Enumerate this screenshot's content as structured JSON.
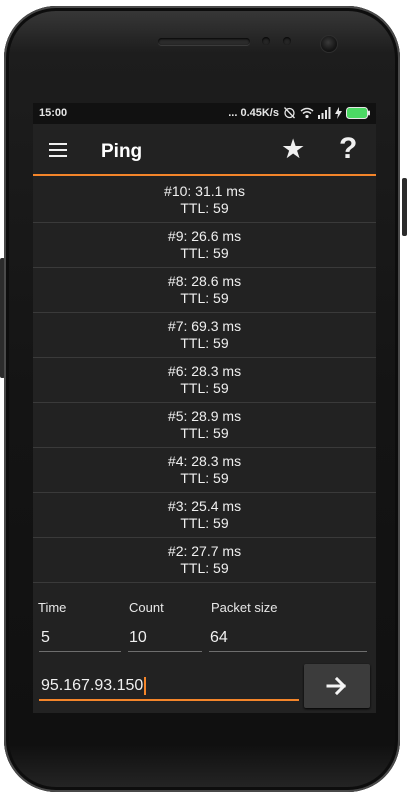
{
  "status_bar": {
    "time": "15:00",
    "speed": "... 0.45K/s"
  },
  "app_bar": {
    "title": "Ping",
    "icons": [
      "menu-icon",
      "star-icon",
      "help-icon"
    ],
    "star_glyph": "★",
    "help_glyph": "?"
  },
  "results": [
    {
      "line1": "#10: 31.1 ms",
      "line2": "TTL: 59"
    },
    {
      "line1": "#9: 26.6 ms",
      "line2": "TTL: 59"
    },
    {
      "line1": "#8: 28.6 ms",
      "line2": "TTL: 59"
    },
    {
      "line1": "#7: 69.3 ms",
      "line2": "TTL: 59"
    },
    {
      "line1": "#6: 28.3 ms",
      "line2": "TTL: 59"
    },
    {
      "line1": "#5: 28.9 ms",
      "line2": "TTL: 59"
    },
    {
      "line1": "#4: 28.3 ms",
      "line2": "TTL: 59"
    },
    {
      "line1": "#3: 25.4 ms",
      "line2": "TTL: 59"
    },
    {
      "line1": "#2: 27.7 ms",
      "line2": "TTL: 59"
    }
  ],
  "form": {
    "time_label": "Time",
    "count_label": "Count",
    "packet_label": "Packet size",
    "time_value": "5",
    "count_value": "10",
    "packet_value": "64",
    "host_value": "95.167.93.150"
  },
  "colors": {
    "accent": "#f4852a",
    "background": "#222222",
    "status_bar": "#111111",
    "battery": "#4cd964"
  }
}
